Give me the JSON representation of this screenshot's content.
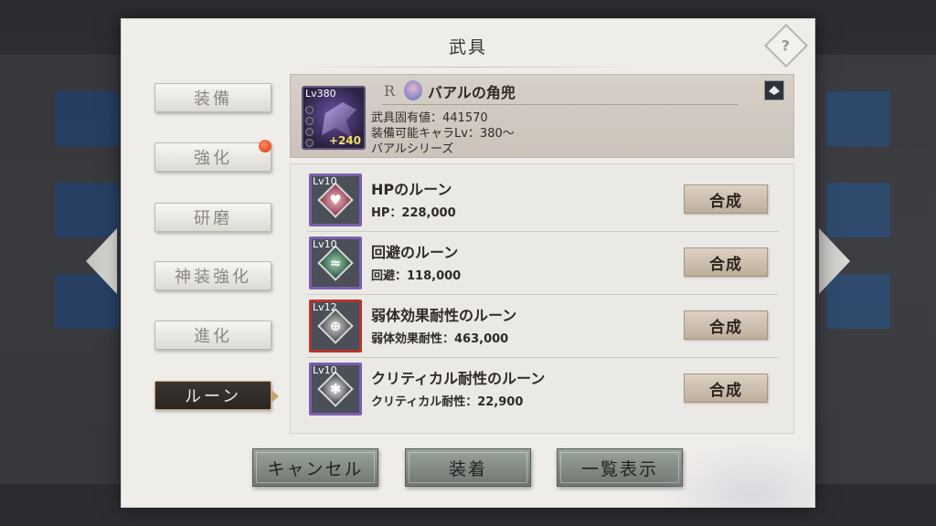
{
  "dialog": {
    "title": "武具",
    "help_icon": "help-diamond-icon"
  },
  "tabs": [
    {
      "label": "装備",
      "active": false
    },
    {
      "label": "強化",
      "active": false,
      "notification": true
    },
    {
      "label": "研磨",
      "active": false
    },
    {
      "label": "神装強化",
      "active": false
    },
    {
      "label": "進化",
      "active": false
    },
    {
      "label": "ルーン",
      "active": true
    }
  ],
  "item": {
    "level": "Lv380",
    "plus": "+240",
    "rarity": "R",
    "name": "バアルの角兜",
    "unique_value": "武具固有値：441570",
    "equip_level": "装備可能キャラLv：380～",
    "series": "バアルシリーズ"
  },
  "runes": [
    {
      "level": "Lv10",
      "name": "HPのルーン",
      "stat": "HP：228,000",
      "button": "合成",
      "frame": "purple",
      "icon": "heart-rune-icon"
    },
    {
      "level": "Lv10",
      "name": "回避のルーン",
      "stat": "回避：118,000",
      "button": "合成",
      "frame": "purple",
      "icon": "evade-rune-icon"
    },
    {
      "level": "Lv12",
      "name": "弱体効果耐性のルーン",
      "stat": "弱体効果耐性：463,000",
      "button": "合成",
      "frame": "red",
      "icon": "debuff-resist-rune-icon"
    },
    {
      "level": "Lv10",
      "name": "クリティカル耐性のルーン",
      "stat": "クリティカル耐性：22,900",
      "button": "合成",
      "frame": "purple",
      "icon": "crit-resist-rune-icon"
    }
  ],
  "footer": {
    "cancel": "キャンセル",
    "equip": "装着",
    "list": "一覧表示"
  },
  "colors": {
    "dialog_bg": "#efedea",
    "active_tab": "#2a2523",
    "notify": "#d83a14",
    "synth_btn": "#bfae9c",
    "footer_btn": "#6f7670"
  }
}
